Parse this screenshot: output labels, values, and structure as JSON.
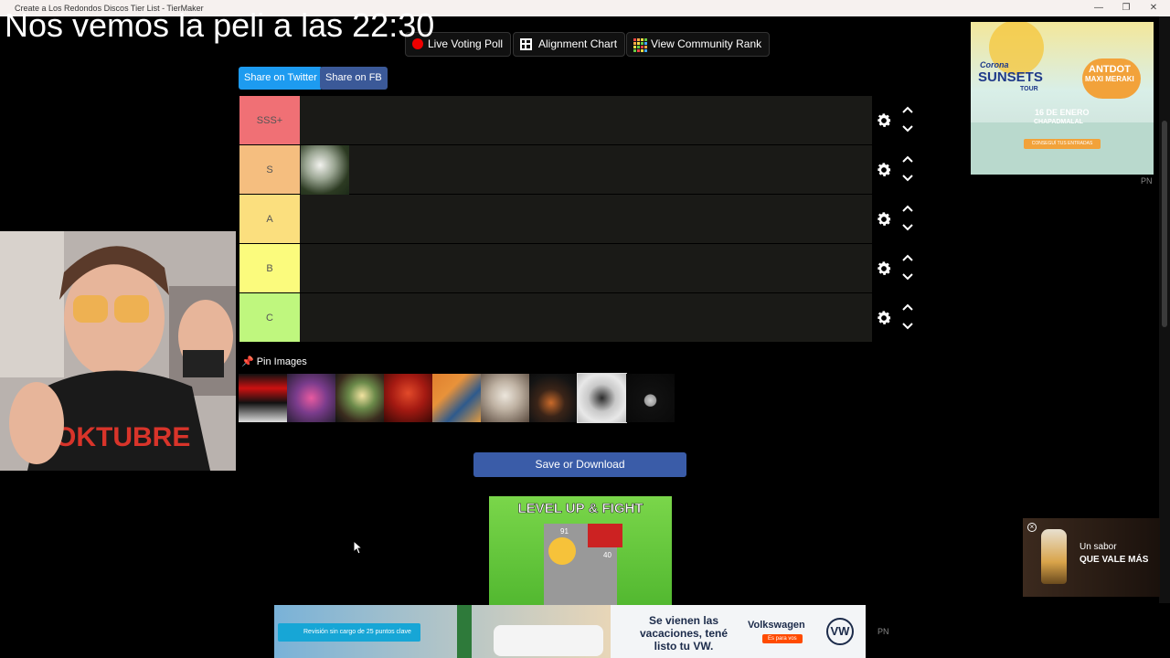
{
  "window": {
    "title": "Create a Los Redondos Discos Tier List - TierMaker",
    "controls": {
      "minimize": "—",
      "maximize": "❐",
      "close": "✕"
    }
  },
  "overlay": {
    "stream_text": "Nos vemos la peli a las 22:30"
  },
  "toolbar": {
    "live_voting_poll": "Live Voting Poll",
    "alignment_chart": "Alignment Chart",
    "view_community_rank": "View Community Rank"
  },
  "share": {
    "twitter": "Share on Twitter",
    "facebook": "Share on FB"
  },
  "tiers": [
    {
      "label": "SSS+",
      "color": "#f07075"
    },
    {
      "label": "S",
      "color": "#f5be7f"
    },
    {
      "label": "A",
      "color": "#fbdf7e"
    },
    {
      "label": "B",
      "color": "#fbfb7d"
    },
    {
      "label": "C",
      "color": "#bff77e"
    }
  ],
  "pin": {
    "label": "Pin Images"
  },
  "save": {
    "label": "Save or Download"
  },
  "ads": {
    "top_right": {
      "brand": "Corona",
      "headline": "SUNSETS",
      "sub": "TOUR",
      "artist": "ANTDOT",
      "artist2": "MAXI MERAKI",
      "date": "16 DE ENERO",
      "place": "CHAPADMALAL",
      "cta": "CONSEGUÍ TUS ENTRADAS",
      "pn": "PN"
    },
    "game": {
      "headline": "LEVEL UP & FIGHT",
      "n1": "91",
      "n2": "40"
    },
    "beer": {
      "line1": "Un sabor",
      "line2": "QUE VALE MÁS"
    },
    "bottom": {
      "pill": "Revisión sin cargo de 25 puntos clave",
      "message": "Se vienen las vacaciones, tené listo tu VW.",
      "brand": "Volkswagen",
      "cta": "Es para vos",
      "logo": "VW",
      "pn": "PN"
    }
  },
  "icons": {
    "gear": "gear-icon",
    "chevron_up": "chevron-up-icon",
    "chevron_down": "chevron-down-icon",
    "pin": "pin-icon",
    "record": "record-dot-icon",
    "grid": "grid-icon",
    "mosaic": "mosaic-icon"
  }
}
